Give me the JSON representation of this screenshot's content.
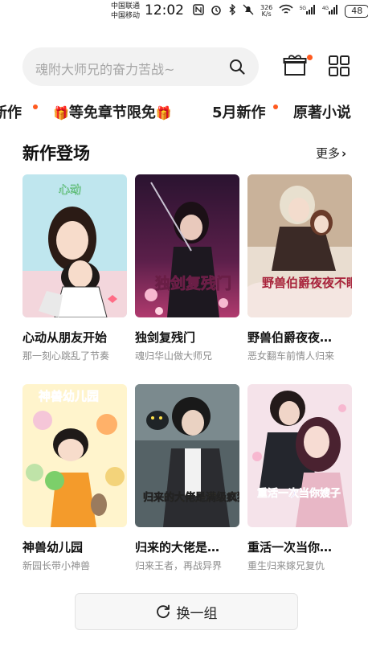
{
  "status_bar": {
    "carrier1": "中国联通",
    "carrier2": "中国移动",
    "time": "12:02",
    "net_speed_value": "326",
    "net_speed_unit": "K/s",
    "battery": "48"
  },
  "search": {
    "placeholder": "魂附大师兄的奋力苦战~"
  },
  "tabs": [
    {
      "label": "新作"
    },
    {
      "label": "等免章节限免"
    },
    {
      "label": "5月新作"
    },
    {
      "label": "原著小说"
    }
  ],
  "section": {
    "title": "新作登场",
    "more": "更多"
  },
  "comics": [
    {
      "title": "心动从朋友开始",
      "subtitle": "那一刻心跳乱了节奏",
      "cover_text": "心动"
    },
    {
      "title": "独剑复残门",
      "subtitle": "魂归华山做大师兄",
      "cover_text": "独剑复残门"
    },
    {
      "title": "野兽伯爵夜夜…",
      "subtitle": "恶女翻车前情人归来",
      "cover_text": "野兽伯爵夜夜不眠"
    },
    {
      "title": "神兽幼儿园",
      "subtitle": "新园长带小神兽",
      "cover_text": "神兽幼儿园"
    },
    {
      "title": "归来的大佬是…",
      "subtitle": "归来王者，再战异界",
      "cover_text": "归来的大佬是满级疯狗"
    },
    {
      "title": "重活一次当你…",
      "subtitle": "重生归来嫁兄复仇",
      "cover_text": "重活一次当你嫂子"
    }
  ],
  "refresh": {
    "label": "换一组"
  },
  "colors": {
    "accent_dot": "#ff5a1f",
    "search_bg": "#f2f2f2"
  }
}
